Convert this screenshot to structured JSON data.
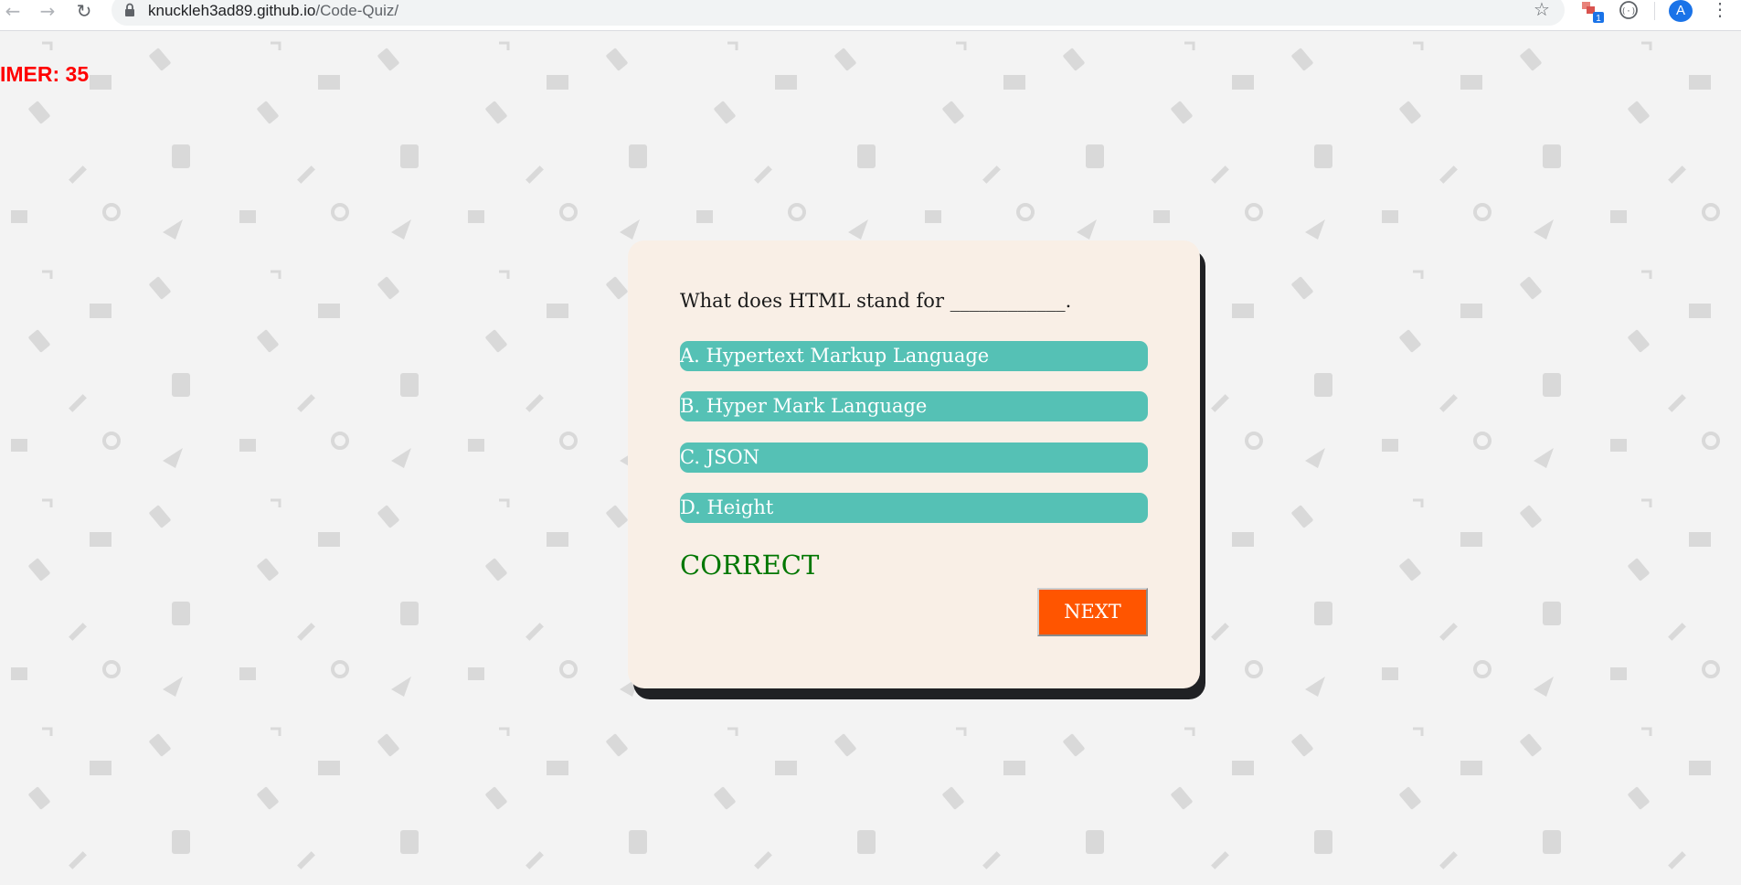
{
  "browser": {
    "url_host": "knuckleh3ad89.github.io",
    "url_path": "/Code-Quiz/",
    "avatar_letter": "A",
    "extension_badge": "1"
  },
  "timer": {
    "text": "IMER: 35",
    "color": "#ff0000"
  },
  "quiz": {
    "question": "What does HTML stand for ____________.",
    "options": [
      "A. Hypertext Markup Language",
      "B. Hyper Mark Language",
      "C. JSON",
      "D. Height"
    ],
    "feedback": "CORRECT",
    "next_label": "NEXT"
  },
  "colors": {
    "option_bg": "#55c1b5",
    "next_bg": "#ff5500",
    "card_bg": "#f9efe6",
    "feedback": "#007700"
  },
  "icons": {
    "back": "arrow-left-icon",
    "forward": "arrow-right-icon",
    "reload": "reload-icon",
    "lock": "lock-icon",
    "bookmark": "star-icon",
    "menu": "kebab-menu-icon"
  }
}
